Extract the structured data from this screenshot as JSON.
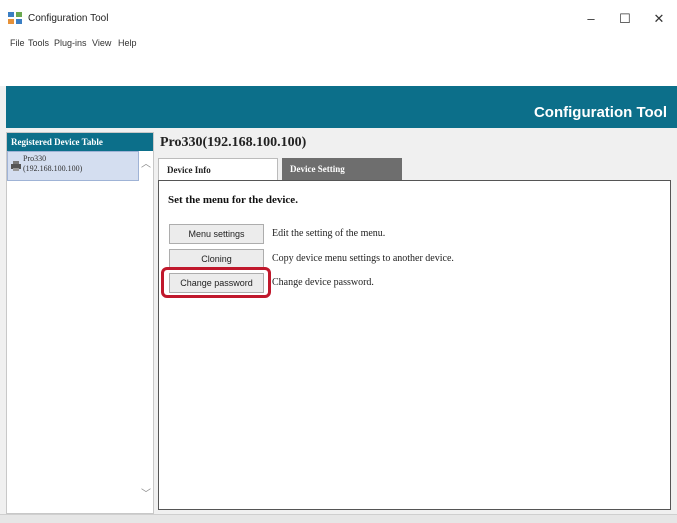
{
  "window": {
    "title": "Configuration Tool",
    "minimize": "–",
    "maximize": "☐",
    "close": "✕"
  },
  "menu": [
    "File",
    "Tools",
    "Plug-ins",
    "View",
    "Help"
  ],
  "banner": {
    "title": "Configuration Tool"
  },
  "left_panel": {
    "header": "Registered Device Table",
    "device": {
      "name": "Pro330",
      "ip": "(192.168.100.100)"
    },
    "scroll_up": "︿",
    "scroll_down": "﹀"
  },
  "main": {
    "device_title": "Pro330(192.168.100.100)",
    "tabs": [
      {
        "label": "Device Info",
        "active": false
      },
      {
        "label": "Device Setting",
        "active": true
      }
    ],
    "heading": "Set the menu for the device.",
    "actions": [
      {
        "button": "Menu settings",
        "description": "Edit the setting of the menu."
      },
      {
        "button": "Cloning",
        "description": "Copy device menu settings to another device."
      },
      {
        "button": "Change password",
        "description": "Change device password."
      }
    ]
  },
  "colors": {
    "banner": "#0c6f8a",
    "highlight": "#c0182c",
    "active_tab": "#6e6e6e"
  },
  "icons": [
    "app-icon",
    "printer-icon",
    "minimize-icon",
    "maximize-icon",
    "close-icon"
  ]
}
